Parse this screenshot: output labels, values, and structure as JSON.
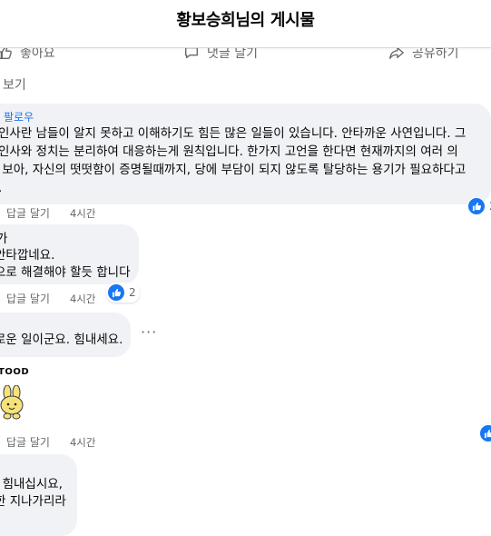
{
  "header": {
    "title": "황보승희님의 게시물"
  },
  "actions": {
    "like": "좋아요",
    "comment": "댓글 달기",
    "share": "공유하기"
  },
  "view_more": "보기",
  "comments": [
    {
      "name": "팔로우",
      "lines": [
        "인사란 남들이 알지 못하고 이해하기도 힘든 많은 일들이 있습니다. 안타까운 사연입니다. 그",
        "인사와 정치는 분리하여 대응하는게 원칙입니다. 한가지 고언을 한다면 현재까지의 여러 의",
        " 보아, 자신의 떳떳함이 증명될때까지, 당에 부담이 되지 않도록 탈당하는 용기가 필요하다고",
        "."
      ],
      "reply": "답글 달기",
      "time": "4시간",
      "reaction_count": "2"
    },
    {
      "lines": [
        "가",
        "안타깝네요.",
        "으로 해결해야 할듯 합니다"
      ],
      "reply": "답글 달기",
      "time": "4시간",
      "reaction_count": "2"
    },
    {
      "lines": [
        "로운 일이군요. 힘내세요."
      ]
    },
    {
      "sticker_label": "TOOD",
      "reply": "답글 달기",
      "time": "4시간"
    },
    {
      "lines": [
        "  힘내십시요,",
        "한 지나가리라"
      ]
    }
  ],
  "colors": {
    "accent": "#1877f2",
    "bubble": "#f0f2f5",
    "muted": "#65676b"
  },
  "icons": [
    "like-icon",
    "comment-icon",
    "share-icon",
    "thumbs-up-icon",
    "more-icon",
    "sticker-icon"
  ]
}
